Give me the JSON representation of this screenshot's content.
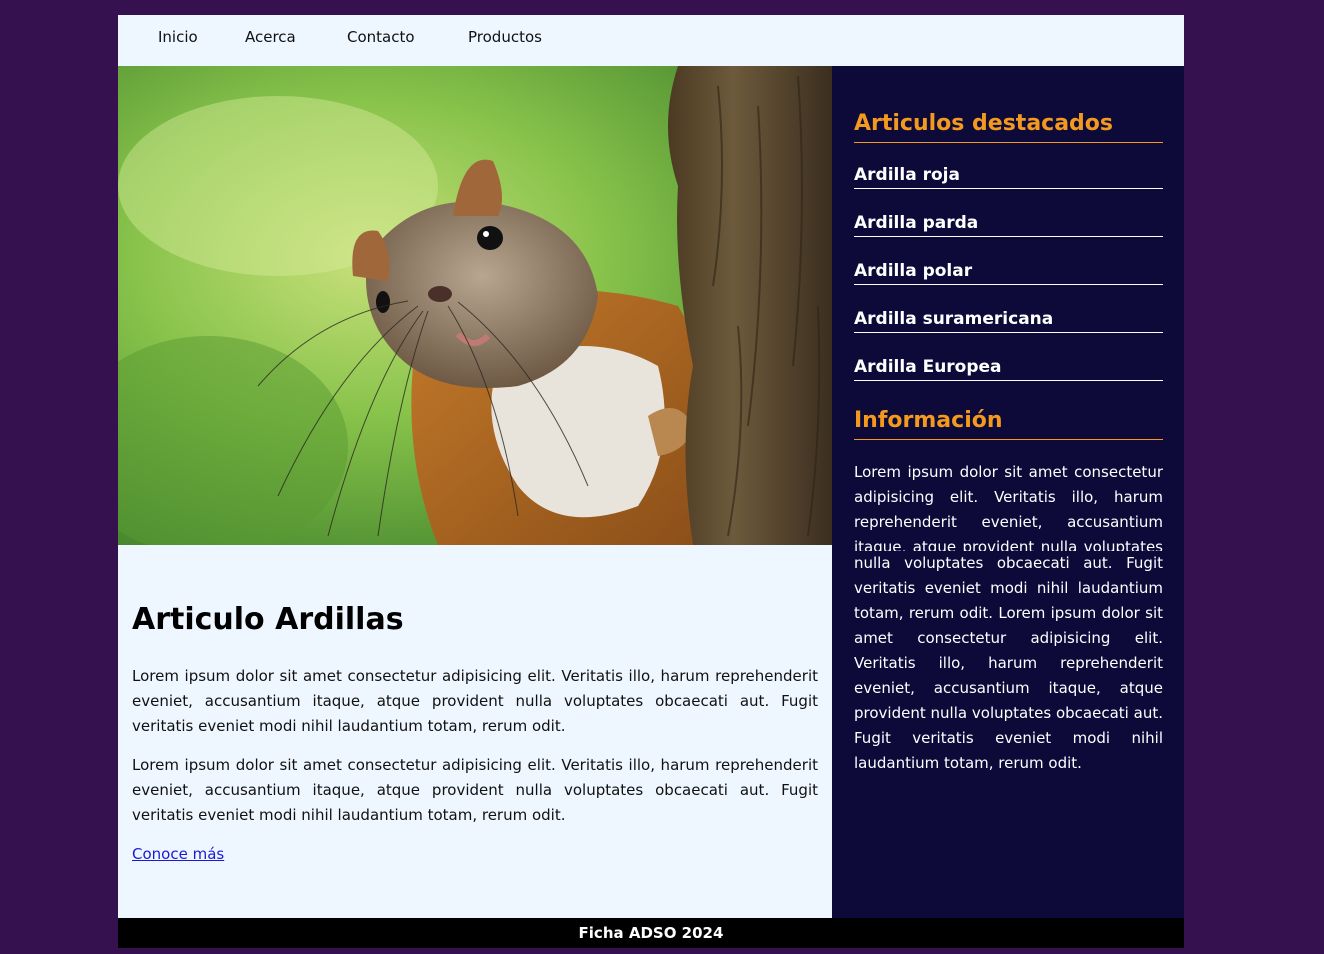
{
  "nav": {
    "items": [
      "Inicio",
      "Acerca",
      "Contacto",
      "Productos"
    ]
  },
  "hero": {
    "image": "squirrel-photo"
  },
  "article": {
    "title": "Articulo Ardillas",
    "paragraphs": [
      "Lorem ipsum dolor sit amet consectetur adipisicing elit. Veritatis illo, harum reprehenderit eveniet, accusantium itaque, atque provident nulla voluptates obcaecati aut. Fugit veritatis eveniet modi nihil laudantium totam, rerum odit.",
      "Lorem ipsum dolor sit amet consectetur adipisicing elit. Veritatis illo, harum reprehenderit eveniet, accusantium itaque, atque provident nulla voluptates obcaecati aut. Fugit veritatis eveniet modi nihil laudantium totam, rerum odit."
    ],
    "link": "Conoce más"
  },
  "sidebar": {
    "featured_title": "Articulos destacados",
    "featured_items": [
      "Ardilla roja",
      "Ardilla parda",
      "Ardilla polar",
      "Ardilla suramericana",
      "Ardilla Europea"
    ],
    "info_title": "Información",
    "info_text_top": "Lorem ipsum dolor sit amet consectetur adipisicing elit. Veritatis illo, harum reprehenderit eveniet, accusantium itaque, atque provident nulla voluptates obcaecati aut. Fugit",
    "info_text_bottom": "nulla voluptates obcaecati aut. Fugit veritatis eveniet modi nihil laudantium totam, rerum odit. Lorem ipsum dolor sit amet consectetur adipisicing elit. Veritatis illo, harum reprehenderit eveniet, accusantium itaque, atque provident nulla voluptates obcaecati aut. Fugit veritatis eveniet modi nihil laudantium totam, rerum odit."
  },
  "footer": {
    "text": "Ficha ADSO 2024"
  },
  "colors": {
    "background": "#351150",
    "light_panel": "#eef6ff",
    "sidebar": "#0d0a3a",
    "accent": "#f39a1e",
    "link": "#1a1ad6"
  }
}
